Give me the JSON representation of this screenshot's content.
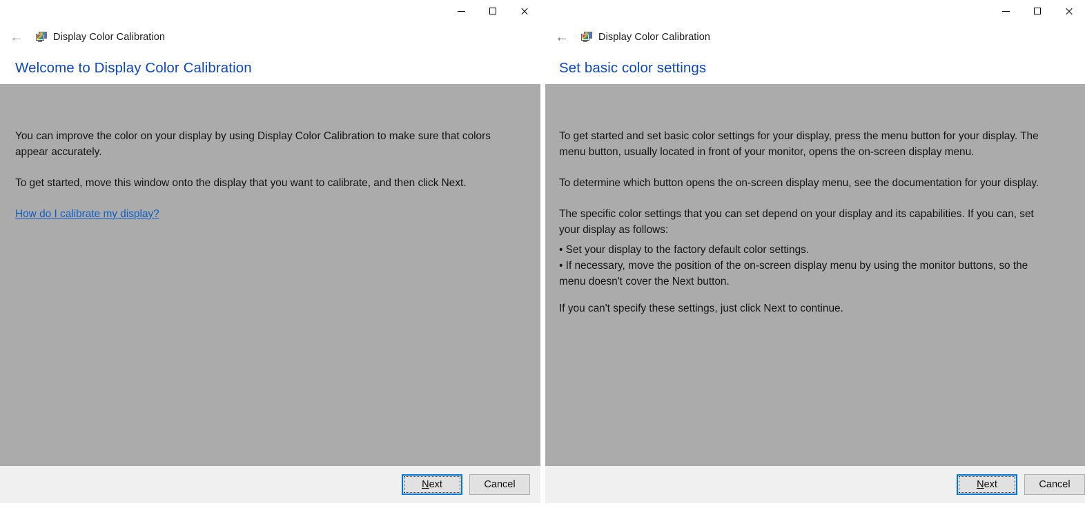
{
  "windows": [
    {
      "id": "left",
      "app_title": "Display Color Calibration",
      "app_icon": "display-color-calibration-icon",
      "back_icon": "back-arrow-icon",
      "caption": {
        "minimize_icon": "minimize-icon",
        "maximize_icon": "maximize-icon",
        "close_icon": "close-icon"
      },
      "heading": "Welcome to Display Color Calibration",
      "paragraphs": [
        "You can improve the color on your display by using Display Color Calibration to make sure that colors appear accurately.",
        "To get started, move this window onto the display that you want to calibrate, and then click Next."
      ],
      "link": "How do I calibrate my display?",
      "buttons": {
        "next_accel": "N",
        "next_rest": "ext",
        "next_label": "Next",
        "cancel_label": "Cancel"
      }
    },
    {
      "id": "right",
      "app_title": "Display Color Calibration",
      "app_icon": "display-color-calibration-icon",
      "back_icon": "back-arrow-icon",
      "caption": {
        "minimize_icon": "minimize-icon",
        "maximize_icon": "maximize-icon",
        "close_icon": "close-icon"
      },
      "heading": "Set basic color settings",
      "paragraphs": [
        "To get started and set basic color settings for your display, press the menu button for your display. The menu button, usually located in front of your monitor, opens the on-screen display menu.",
        "To determine which button opens the on-screen display menu, see the documentation for your display.",
        "The specific color settings that you can set depend on your display and its capabilities. If you can, set your display as follows:"
      ],
      "bullets": "• Set your display to the factory default color settings.\n• If necessary, move the position of the on-screen display menu by using the monitor buttons, so the menu doesn't cover the Next button.",
      "closing": "If you can't specify these settings,  just click Next to continue.",
      "buttons": {
        "next_accel": "N",
        "next_rest": "ext",
        "next_label": "Next",
        "cancel_label": "Cancel"
      }
    }
  ],
  "colors": {
    "heading_blue": "#0d47c4",
    "link_blue": "#0f5fc4",
    "calibration_gray": "#ababab",
    "footer_gray": "#f0f0f0",
    "focus_blue": "#0078d7",
    "button_face": "#e1e1e1"
  }
}
